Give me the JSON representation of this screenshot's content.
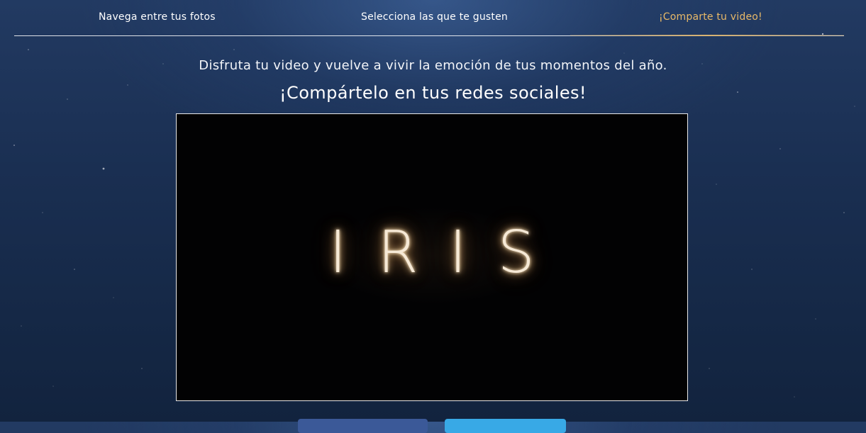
{
  "steps": {
    "items": [
      {
        "label": "Navega entre tus fotos",
        "active": false
      },
      {
        "label": "Selecciona las que te gusten",
        "active": false
      },
      {
        "label": "¡Comparte tu video!",
        "active": true
      }
    ],
    "active_color": "#e8b968"
  },
  "content": {
    "lead": "Disfruta tu video y vuelve a vivir la emoción de tus momentos del año.",
    "headline": "¡Compártelo en tus redes sociales!"
  },
  "video": {
    "title_text": "IRIS"
  },
  "share": {
    "facebook_color": "#3b5998",
    "twitter_color": "#38a9e6"
  }
}
